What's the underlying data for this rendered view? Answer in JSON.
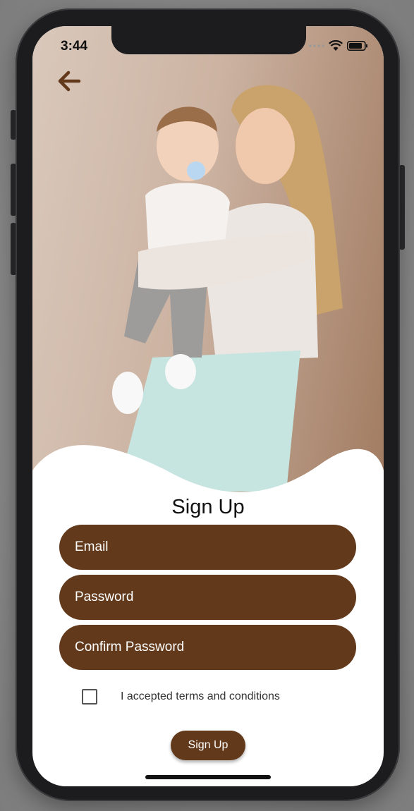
{
  "status_bar": {
    "time": "3:44",
    "icons": [
      "signal-dots-icon",
      "wifi-icon",
      "battery-icon"
    ]
  },
  "header": {
    "back_icon": "arrow-left-icon"
  },
  "hero": {
    "image": "woman-holding-baby-photo"
  },
  "form": {
    "title": "Sign Up",
    "email_placeholder": "Email",
    "password_placeholder": "Password",
    "confirm_password_placeholder": "Confirm Password",
    "terms_label": "I accepted terms and conditions",
    "terms_checked": false,
    "submit_label": "Sign Up"
  },
  "colors": {
    "primary": "#62391B",
    "background": "#FFFFFF",
    "text": "#111111"
  }
}
